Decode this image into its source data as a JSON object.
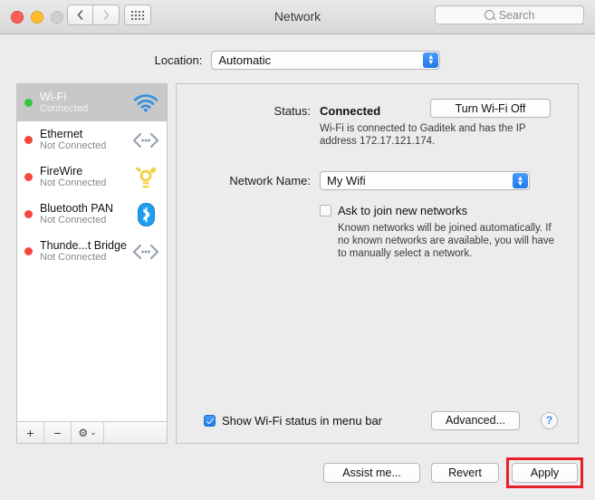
{
  "titlebar": {
    "title": "Network",
    "back_icon": "chevron-left-icon",
    "forward_icon": "chevron-right-icon",
    "grid_icon": "grid-view-icon",
    "search_placeholder": "Search",
    "search_icon": "search-icon",
    "close_label": "close",
    "minimize_label": "minimize",
    "zoom_label": "zoom"
  },
  "location": {
    "label": "Location:",
    "value": "Automatic",
    "options": [
      "Automatic"
    ]
  },
  "sidebar": {
    "services": [
      {
        "name": "Wi-Fi",
        "state": "Connected",
        "status_color": "#36c940",
        "selected": true,
        "icon": "wifi-icon"
      },
      {
        "name": "Ethernet",
        "state": "Not Connected",
        "status_color": "#f8463f",
        "selected": false,
        "icon": "ethernet-icon"
      },
      {
        "name": "FireWire",
        "state": "Not Connected",
        "status_color": "#f8463f",
        "selected": false,
        "icon": "firewire-icon"
      },
      {
        "name": "Bluetooth PAN",
        "state": "Not Connected",
        "status_color": "#f8463f",
        "selected": false,
        "icon": "bluetooth-icon"
      },
      {
        "name": "Thunde...t Bridge",
        "state": "Not Connected",
        "status_color": "#f8463f",
        "selected": false,
        "icon": "ethernet-icon"
      }
    ],
    "toolbar": {
      "add_label": "+",
      "remove_label": "−",
      "gear_label": "⚙",
      "gear_chevron": "⌄"
    }
  },
  "main": {
    "status_label": "Status:",
    "status_value": "Connected",
    "wifi_toggle_label": "Turn Wi-Fi Off",
    "status_description": "Wi-Fi is connected to Gaditek and has the IP address 172.17.121.174.",
    "network_name_label": "Network Name:",
    "network_name_value": "My Wifi",
    "ask_to_join_label": "Ask to join new networks",
    "ask_to_join_checked": false,
    "ask_to_join_description": "Known networks will be joined automatically. If no known networks are available, you will have to manually select a network.",
    "show_status_label": "Show Wi-Fi status in menu bar",
    "show_status_checked": true,
    "advanced_label": "Advanced...",
    "help_label": "?"
  },
  "footer": {
    "assist_label": "Assist me...",
    "revert_label": "Revert",
    "apply_label": "Apply",
    "highlight_color": "#e8202a"
  }
}
